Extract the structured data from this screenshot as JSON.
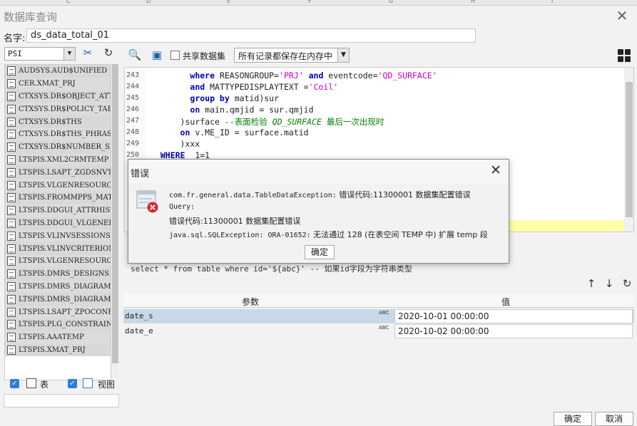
{
  "window": {
    "title": "数据库查询"
  },
  "name_row": {
    "label": "名字:",
    "value": "ds_data_total_01"
  },
  "left": {
    "schema": "PSI",
    "tables": [
      "AUDSYS.AUD$UNIFIED",
      "CER.XMAT_PRJ",
      "CTXSYS.DR$OBJECT_ATTR",
      "CTXSYS.DR$POLICY_TAB",
      "CTXSYS.DR$THS",
      "CTXSYS.DR$THS_PHRASE",
      "CTXSYS.DR$NUMBER_SEQU",
      "LTSPIS.XML2CRMTEMP",
      "LTSPIS.LSAPT_ZGDSNVTC",
      "LTSPIS.VLGENRESOURCER",
      "LTSPIS.FROMMPPS_MAT",
      "LTSPIS.DDGUI_ATTRHIST",
      "LTSPIS.DDGUI_VLGENERA",
      "LTSPIS.VLINVSESSIONSI",
      "LTSPIS.VLINVCRITERION",
      "LTSPIS.VLGENRESOURCER",
      "LTSPIS.DMRS_DESIGNS",
      "LTSPIS.DMRS_DIAGRAMS",
      "LTSPIS.DMRS_DIAGRAM_E",
      "LTSPIS.LSAPT_ZPOCONFC",
      "LTSPIS.PLG_CONSTRAINT",
      "LTSPIS.AAATEMP",
      "LTSPIS.XMAT_PRJ"
    ],
    "table_cb_label": "表",
    "view_cb_label": "视图"
  },
  "toolbar": {
    "share_label": "共享数据集",
    "memory_option": "所有记录都保存在内存中"
  },
  "editor": {
    "lines": [
      {
        "n": "243",
        "html": "        <span class='kw'>where</span> REASONGROUP=<span class='str'>'PRJ'</span> <span class='kw'>and</span> eventcode=<span class='str'>'QD_SURFACE'</span>"
      },
      {
        "n": "244",
        "html": "        <span class='kw'>and</span> MATTYPEDISPLAYTEXT =<span class='str'>'Coil'</span>"
      },
      {
        "n": "245",
        "html": "        <span class='kw'>group by</span> matid)sur"
      },
      {
        "n": "246",
        "html": "        <span class='kw'>on</span> main.qmjid = sur.qmjid"
      },
      {
        "n": "247",
        "html": "      )surface <span class='cmt'>--表面检验 <i>QD_SURFACE</i> 最后一次出现时</span>"
      },
      {
        "n": "248",
        "html": "      <span class='kw'>on</span> v.ME_ID = surface.matid"
      },
      {
        "n": "249",
        "html": "      )xxx"
      },
      {
        "n": "250",
        "html": "  <span class='kw'>WHERE</span>  1=1"
      }
    ]
  },
  "hint": "select * from table where id='${abc}' -- 如果id字段为字符串类型",
  "params": {
    "col_name": "参数",
    "col_value": "值",
    "rows": [
      {
        "name": "date_s",
        "type": "ABC",
        "value": "2020-10-01 00:00:00"
      },
      {
        "name": "date_e",
        "type": "ABC",
        "value": "2020-10-02 00:00:00"
      }
    ]
  },
  "dialog": {
    "title": "错误",
    "line1_prefix": "com.fr.general.data.TableDataException:",
    "line1_suffix": " 错误代码:11300001 数据集配置错误",
    "line2": "Query:",
    "line3": "错误代码:11300001 数据集配置错误",
    "line4_prefix": "java.sql.SQLException: ORA-01652:",
    "line4_suffix": " 无法通过 128 (在表空间 TEMP 中) 扩展 temp 段",
    "ok": "确定"
  },
  "buttons": {
    "ok": "确定",
    "cancel": "取消"
  },
  "colors": {
    "accent": "#2d7fd6",
    "error": "#e0242a",
    "keyword": "#0000b4",
    "string": "#c800c8",
    "comment": "#008000"
  },
  "icons": [
    "close-icon",
    "tools-icon",
    "refresh-icon",
    "preview-icon",
    "save-icon",
    "grid-icon",
    "arrow-up-icon",
    "arrow-down-icon",
    "error-icon",
    "table-icon",
    "view-icon"
  ]
}
